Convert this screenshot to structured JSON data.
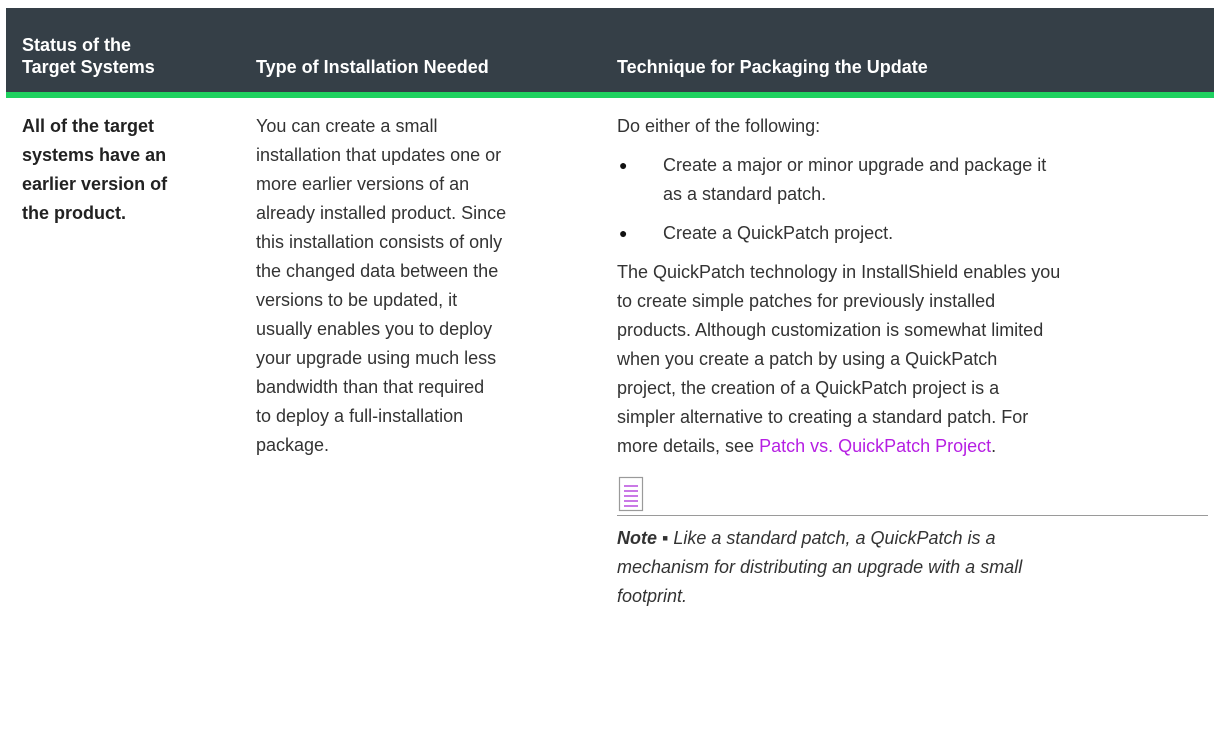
{
  "headers": {
    "col1": [
      "Status of the",
      "Target Systems"
    ],
    "col2": "Type of Installation Needed",
    "col3": "Technique for Packaging the Update"
  },
  "row": {
    "status": [
      "All of the target",
      "systems have an",
      "earlier version of",
      "the product."
    ],
    "installation_lines": [
      "You can create a small",
      "installation that updates one or",
      "more earlier versions of an",
      "already installed product. Since",
      "this installation consists of only",
      "the changed data between the",
      "versions to be updated, it",
      "usually enables you to deploy",
      "your upgrade using much less",
      "bandwidth than that required",
      "to deploy a full-installation",
      "package."
    ],
    "technique": {
      "intro": "Do either of the following:",
      "bullets": [
        [
          "Create a major or minor upgrade and package it",
          "as a standard patch."
        ],
        [
          "Create a QuickPatch project."
        ]
      ],
      "paragraph_lines": [
        "The QuickPatch technology in InstallShield enables you",
        "to create simple patches for previously installed",
        "products. Although customization is somewhat limited",
        "when you create a patch by using a QuickPatch",
        "project, the creation of a QuickPatch project is a",
        "simpler alternative to creating a standard patch. For"
      ],
      "last_line_prefix": "more details, see ",
      "link_text": "Patch vs. QuickPatch Project",
      "last_line_suffix": ".",
      "note_label": "Note ▪",
      "note_lines": [
        " Like a standard patch, a QuickPatch is a",
        "mechanism for distributing an upgrade with a small",
        "footprint."
      ]
    }
  },
  "icons": {
    "bullet": "●",
    "note": "note-icon"
  },
  "colors": {
    "header_bg": "#353f47",
    "accent": "#1fd15f",
    "link": "#b61fe3",
    "note_icon": "#a61fd6"
  }
}
